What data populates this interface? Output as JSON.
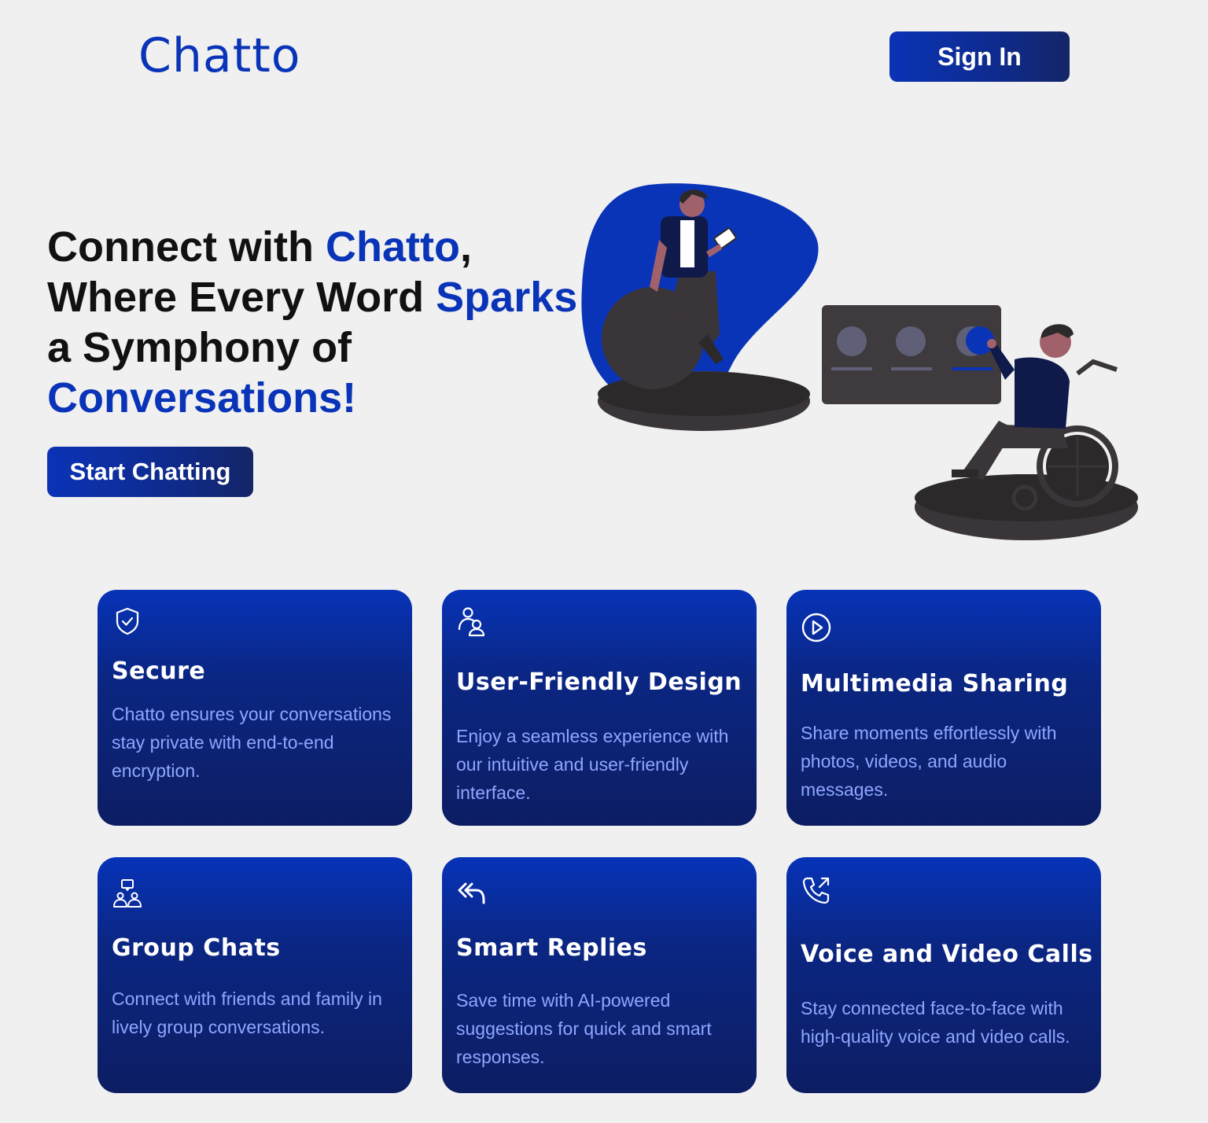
{
  "header": {
    "logo": "Chatto",
    "signin_label": "Sign In"
  },
  "hero": {
    "line1_a": "Connect with ",
    "line1_accent": "Chatto",
    "line1_b": ",",
    "line2_a": "Where Every Word ",
    "line2_accent": "Sparks",
    "line3": "a Symphony of",
    "line4_accent": "Conversations!",
    "cta_label": "Start Chatting"
  },
  "colors": {
    "brand": "#0a34b8",
    "card_top": "#0733b8",
    "card_bottom": "#0c1d62",
    "card_text": "#8ea6ff",
    "background": "#f0f0f0"
  },
  "features": [
    {
      "icon": "shield-check-icon",
      "title": "Secure",
      "desc": "Chatto ensures your conversations stay private with end-to-end encryption."
    },
    {
      "icon": "user-friendly-icon",
      "title": "User-Friendly Design",
      "desc": "Enjoy a seamless experience with our intuitive and user-friendly interface."
    },
    {
      "icon": "play-circle-icon",
      "title": "Multimedia Sharing",
      "desc": "Share moments effortlessly with photos, videos, and audio messages."
    },
    {
      "icon": "group-chat-icon",
      "title": "Group Chats",
      "desc": "Connect with friends and family in lively group conversations."
    },
    {
      "icon": "reply-all-icon",
      "title": "Smart Replies",
      "desc": "Save time with AI-powered suggestions for quick and smart responses."
    },
    {
      "icon": "phone-outgoing-icon",
      "title": "Voice and Video Calls",
      "desc": "Stay connected face-to-face with high-quality voice and video calls."
    }
  ]
}
